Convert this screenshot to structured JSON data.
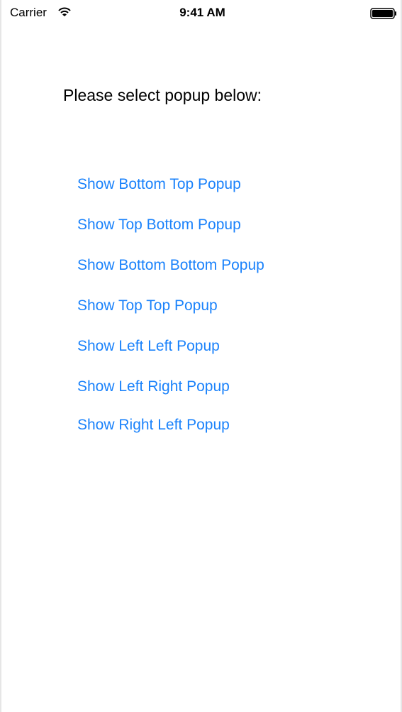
{
  "status_bar": {
    "carrier": "Carrier",
    "time": "9:41 AM",
    "wifi_icon": "wifi-icon",
    "battery_icon": "battery-icon"
  },
  "main": {
    "prompt": "Please select popup below:",
    "buttons": [
      {
        "label": "Show Bottom Top Popup"
      },
      {
        "label": "Show Top Bottom Popup"
      },
      {
        "label": "Show Bottom Bottom Popup"
      },
      {
        "label": "Show Top Top Popup"
      },
      {
        "label": "Show Left Left Popup"
      },
      {
        "label": "Show Left Right Popup"
      },
      {
        "label": "Show Right Left Popup"
      }
    ]
  },
  "colors": {
    "tint": "#1a82fb",
    "text": "#000000",
    "background": "#ffffff"
  }
}
